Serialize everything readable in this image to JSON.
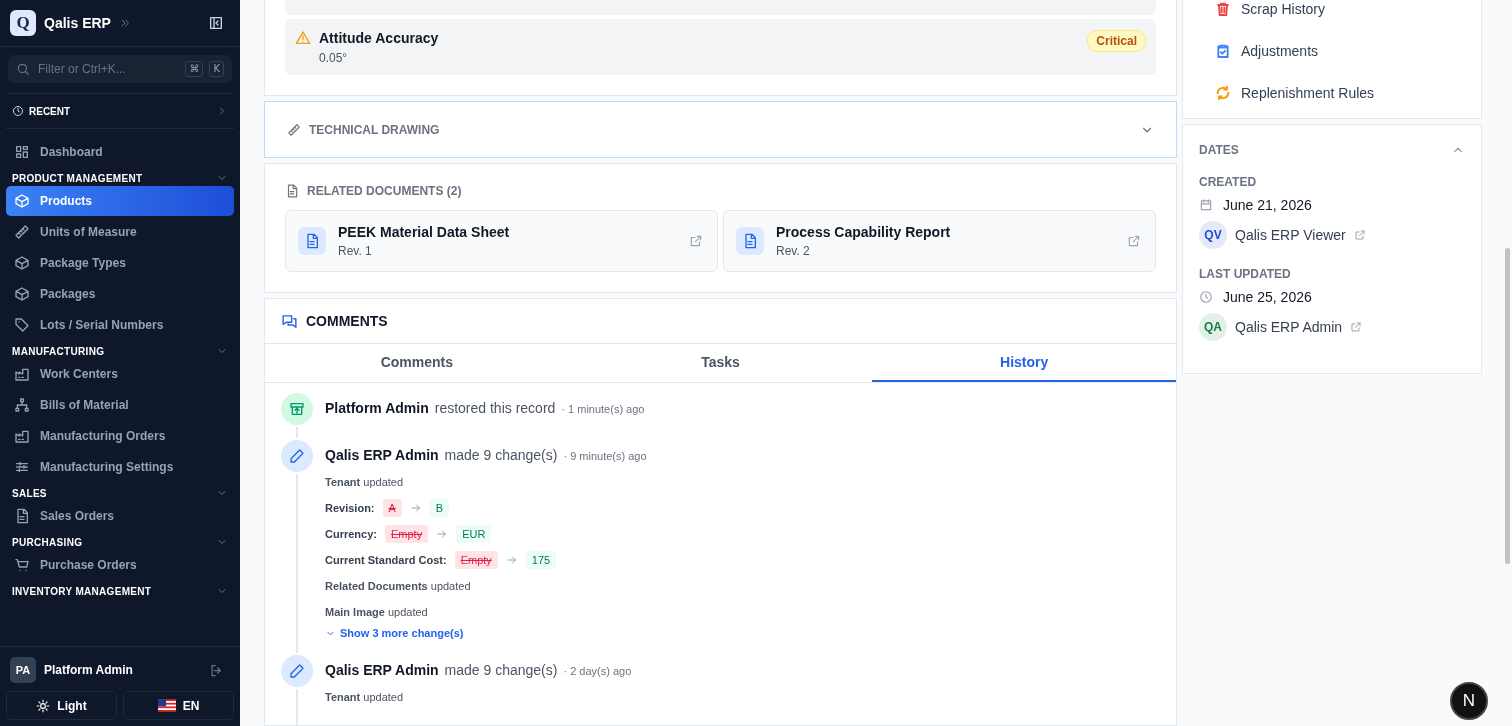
{
  "sidebar": {
    "logo": "Q",
    "brand": "Qalis ERP",
    "search": {
      "placeholder": "Filter or Ctrl+K...",
      "keys": [
        "⌘",
        "K"
      ]
    },
    "recent": "RECENT",
    "top_items": [
      {
        "label": "Dashboard",
        "selected": false
      }
    ],
    "groups": [
      {
        "title": "PRODUCT MANAGEMENT",
        "expanded": true,
        "items": [
          {
            "label": "Products",
            "selected": true
          },
          {
            "label": "Units of Measure",
            "selected": false
          },
          {
            "label": "Package Types",
            "selected": false
          },
          {
            "label": "Packages",
            "selected": false
          },
          {
            "label": "Lots / Serial Numbers",
            "selected": false
          }
        ]
      },
      {
        "title": "MANUFACTURING",
        "expanded": true,
        "items": [
          {
            "label": "Work Centers",
            "selected": false
          },
          {
            "label": "Bills of Material",
            "selected": false
          },
          {
            "label": "Manufacturing Orders",
            "selected": false
          },
          {
            "label": "Manufacturing Settings",
            "selected": false
          }
        ]
      },
      {
        "title": "SALES",
        "expanded": true,
        "items": [
          {
            "label": "Sales Orders",
            "selected": false
          }
        ]
      },
      {
        "title": "PURCHASING",
        "expanded": true,
        "items": [
          {
            "label": "Purchase Orders",
            "selected": false
          }
        ]
      },
      {
        "title": "INVENTORY MANAGEMENT",
        "expanded": true
      }
    ],
    "user": {
      "initials": "PA",
      "name": "Platform Admin"
    },
    "theme_button": "Light",
    "language_button": "EN"
  },
  "specs": [
    {
      "name": "Attitude Accuracy",
      "value": "0.05°",
      "badge": "Critical"
    }
  ],
  "technical_drawing": {
    "title": "TECHNICAL DRAWING",
    "expanded": false
  },
  "related_documents": {
    "title": "RELATED DOCUMENTS (2)",
    "documents": [
      {
        "name": "PEEK Material Data Sheet",
        "revision": "Rev. 1"
      },
      {
        "name": "Process Capability Report",
        "revision": "Rev. 2"
      }
    ]
  },
  "comments": {
    "title": "COMMENTS",
    "tabs": [
      {
        "label": "Comments",
        "selected": false
      },
      {
        "label": "Tasks",
        "selected": false
      },
      {
        "label": "History",
        "selected": true
      }
    ],
    "history": [
      {
        "kind": "restore",
        "user": "Platform Admin",
        "action": "restored this record",
        "time": "· 1 minute(s) ago"
      },
      {
        "kind": "edit",
        "user": "Qalis ERP Admin",
        "action": "made 9 change(s)",
        "time": "· 9 minute(s) ago",
        "changes": [
          {
            "kind": "note",
            "text": "**Tenant** updated"
          },
          {
            "kind": "diff",
            "field": "Revision:",
            "from": "A",
            "to": "B"
          },
          {
            "kind": "diff",
            "field": "Currency:",
            "from": "Empty",
            "to": "EUR"
          },
          {
            "kind": "diff",
            "field": "Current Standard Cost:",
            "from": "Empty",
            "to": "175"
          },
          {
            "kind": "note",
            "text": "**Related Documents** updated"
          },
          {
            "kind": "note",
            "text": "**Main Image** updated"
          }
        ],
        "more": "Show 3 more change(s)"
      },
      {
        "kind": "edit",
        "user": "Qalis ERP Admin",
        "action": "made 9 change(s)",
        "time": "· 2 day(s) ago",
        "changes": [
          {
            "kind": "note",
            "text": "**Tenant** updated"
          }
        ]
      }
    ]
  },
  "related_links": [
    {
      "label": "Scrap History",
      "color": "#ef4444"
    },
    {
      "label": "Adjustments",
      "color": "#3b82f6"
    },
    {
      "label": "Replenishment Rules",
      "color": "#f59e0b"
    }
  ],
  "dates": {
    "title": "DATES",
    "expanded": true,
    "entries": [
      {
        "label": "CREATED",
        "date": "June 21, 2026",
        "initials": "QV",
        "user": "Qalis ERP Viewer",
        "color": "#1d4ed8"
      },
      {
        "label": "LAST UPDATED",
        "date": "June 25, 2026",
        "initials": "QA",
        "user": "Qalis ERP Admin",
        "color": "#15803d"
      }
    ]
  },
  "dev_badge": "N"
}
